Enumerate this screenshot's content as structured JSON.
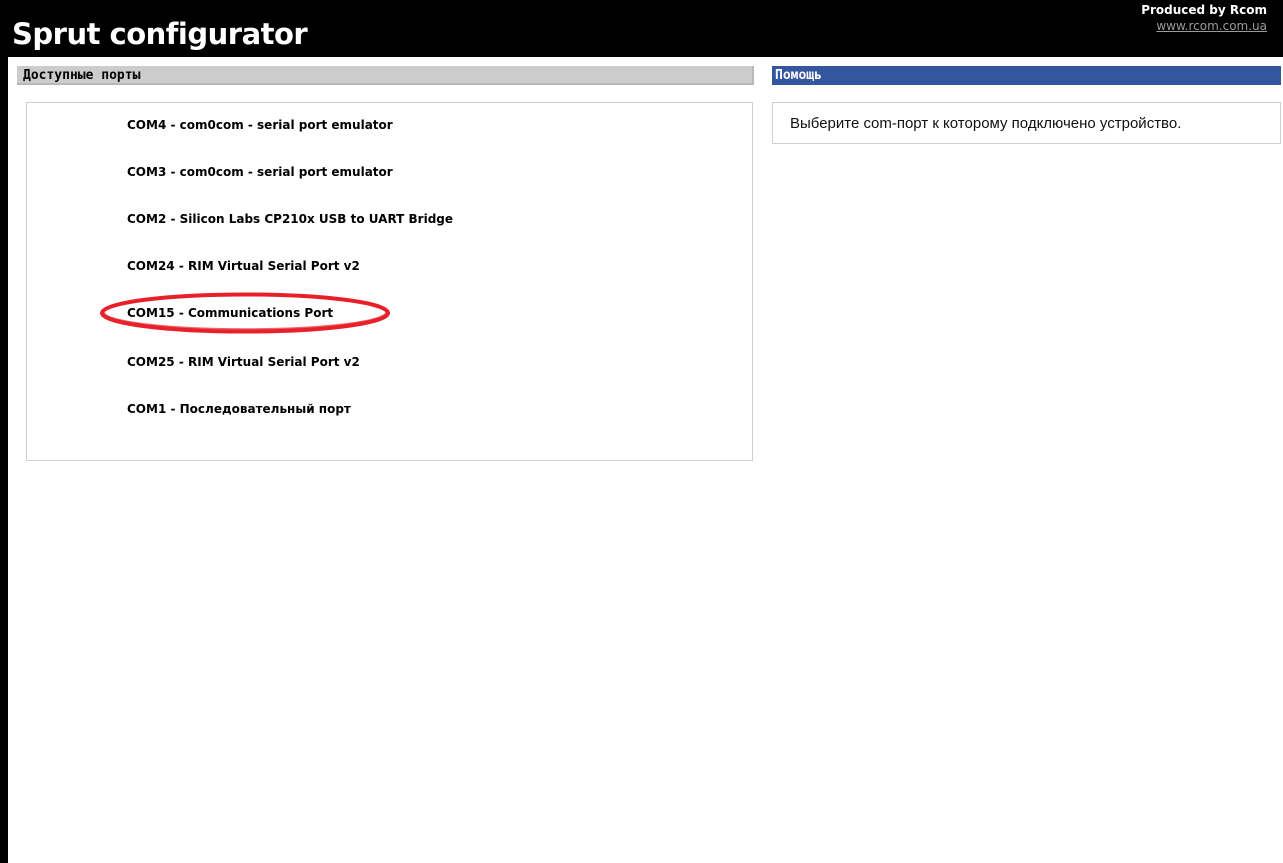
{
  "app": {
    "title": "Sprut configurator",
    "producer": "Produced by Rcom",
    "producer_link": "www.rcom.com.ua"
  },
  "ports_section": {
    "title": "Доступные порты",
    "ports": [
      {
        "label": "COM4 - com0com - serial port emulator"
      },
      {
        "label": "COM3 - com0com - serial port emulator"
      },
      {
        "label": "COM2 - Silicon Labs CP210x USB to UART Bridge"
      },
      {
        "label": "COM24 - RIM Virtual Serial Port v2"
      },
      {
        "label": "COM15 - Communications Port",
        "highlighted": true
      },
      {
        "label": "COM25 - RIM Virtual Serial Port v2"
      },
      {
        "label": "COM1 - Последовательный порт"
      }
    ]
  },
  "help_section": {
    "title": "Помощь",
    "text": "Выберите com-порт к которому подключено устройство."
  },
  "colors": {
    "header_bg": "#000000",
    "help_bar_bg": "#34569f",
    "ports_bar_bg": "#cccccc",
    "highlight": "#e8202a"
  }
}
